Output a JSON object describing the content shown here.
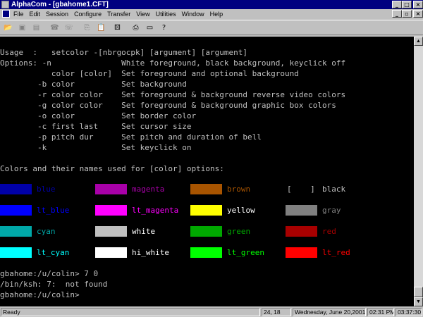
{
  "window": {
    "title": "AlphaCom - [gbahome1.CFT]"
  },
  "titlebar_buttons": {
    "minimize": "_",
    "maximize": "□",
    "close": "×"
  },
  "doc_buttons": {
    "minimize": "_",
    "restore": "▫",
    "close": "×"
  },
  "menu": [
    "File",
    "Edit",
    "Session",
    "Configure",
    "Transfer",
    "View",
    "Utilities",
    "Window",
    "Help"
  ],
  "toolbar": [
    {
      "icon": "open-folder-icon",
      "glyph": "📂",
      "enabled": true
    },
    {
      "icon": "disk-icon",
      "glyph": "▣",
      "enabled": false
    },
    {
      "icon": "save-icon",
      "glyph": "▤",
      "enabled": false
    },
    {
      "icon": "connect-phone-icon",
      "glyph": "☎",
      "enabled": false
    },
    {
      "icon": "disconnect-phone-icon",
      "glyph": "☏",
      "enabled": false
    },
    {
      "icon": "copy-icon",
      "glyph": "⎘",
      "enabled": false
    },
    {
      "icon": "paste-icon",
      "glyph": "📋",
      "enabled": true
    },
    {
      "icon": "dice-icon",
      "glyph": "⚄",
      "enabled": true
    },
    {
      "icon": "print-icon",
      "glyph": "⎙",
      "enabled": true
    },
    {
      "icon": "window-icon",
      "glyph": "▭",
      "enabled": true
    },
    {
      "icon": "help-icon",
      "glyph": "?",
      "enabled": true
    }
  ],
  "terminal": {
    "lines": [
      "Usage  :   setcolor -[nbrgocpk] [argument] [argument]",
      "Options: -n               White foreground, black background, keyclick off",
      "           color [color]  Set foreground and optional background",
      "        -b color          Set background",
      "        -r color color    Set foreground & background reverse video colors",
      "        -g color color    Set foreground & background graphic box colors",
      "        -o color          Set border color",
      "        -c first last     Set cursor size",
      "        -p pitch dur      Set pitch and duration of bell",
      "        -k                Set keyclick on",
      "",
      "Colors and their names used for [color] options:"
    ],
    "colors": [
      {
        "name": "blue",
        "swatch": "#0000a8",
        "text": "#0000a8"
      },
      {
        "name": "magenta",
        "swatch": "#a800a8",
        "text": "#a800a8"
      },
      {
        "name": "brown",
        "swatch": "#a85400",
        "text": "#a85400"
      },
      {
        "name": "black",
        "swatch": "#000000",
        "text": "#c0c0c0",
        "bracket": "[    ]"
      },
      {
        "name": "lt_blue",
        "swatch": "#0000ff",
        "text": "#0000ff"
      },
      {
        "name": "lt_magenta",
        "swatch": "#ff00ff",
        "text": "#ff00ff"
      },
      {
        "name": "yellow",
        "swatch": "#ffff00",
        "text": "#ffffff"
      },
      {
        "name": "gray",
        "swatch": "#808080",
        "text": "#808080"
      },
      {
        "name": "cyan",
        "swatch": "#00a8a8",
        "text": "#00a8a8"
      },
      {
        "name": "white",
        "swatch": "#c0c0c0",
        "text": "#ffffff"
      },
      {
        "name": "green",
        "swatch": "#00a800",
        "text": "#00a800"
      },
      {
        "name": "red",
        "swatch": "#a80000",
        "text": "#a80000"
      },
      {
        "name": "lt_cyan",
        "swatch": "#00ffff",
        "text": "#00ffff"
      },
      {
        "name": "hi_white",
        "swatch": "#ffffff",
        "text": "#ffffff"
      },
      {
        "name": "lt_green",
        "swatch": "#00ff00",
        "text": "#00ff00"
      },
      {
        "name": "lt_red",
        "swatch": "#ff0000",
        "text": "#ff0000"
      }
    ],
    "shell": [
      "gbahome:/u/colin> 7 0",
      "/bin/ksh: 7:  not found",
      "gbahome:/u/colin>"
    ]
  },
  "scrollbar": {
    "up": "▲",
    "down": "▼"
  },
  "status": {
    "ready": "Ready",
    "cursor": "24, 18",
    "date": "Wednesday, June 20,2001",
    "time": "02:31 PM",
    "elapsed": "03:37:30"
  }
}
